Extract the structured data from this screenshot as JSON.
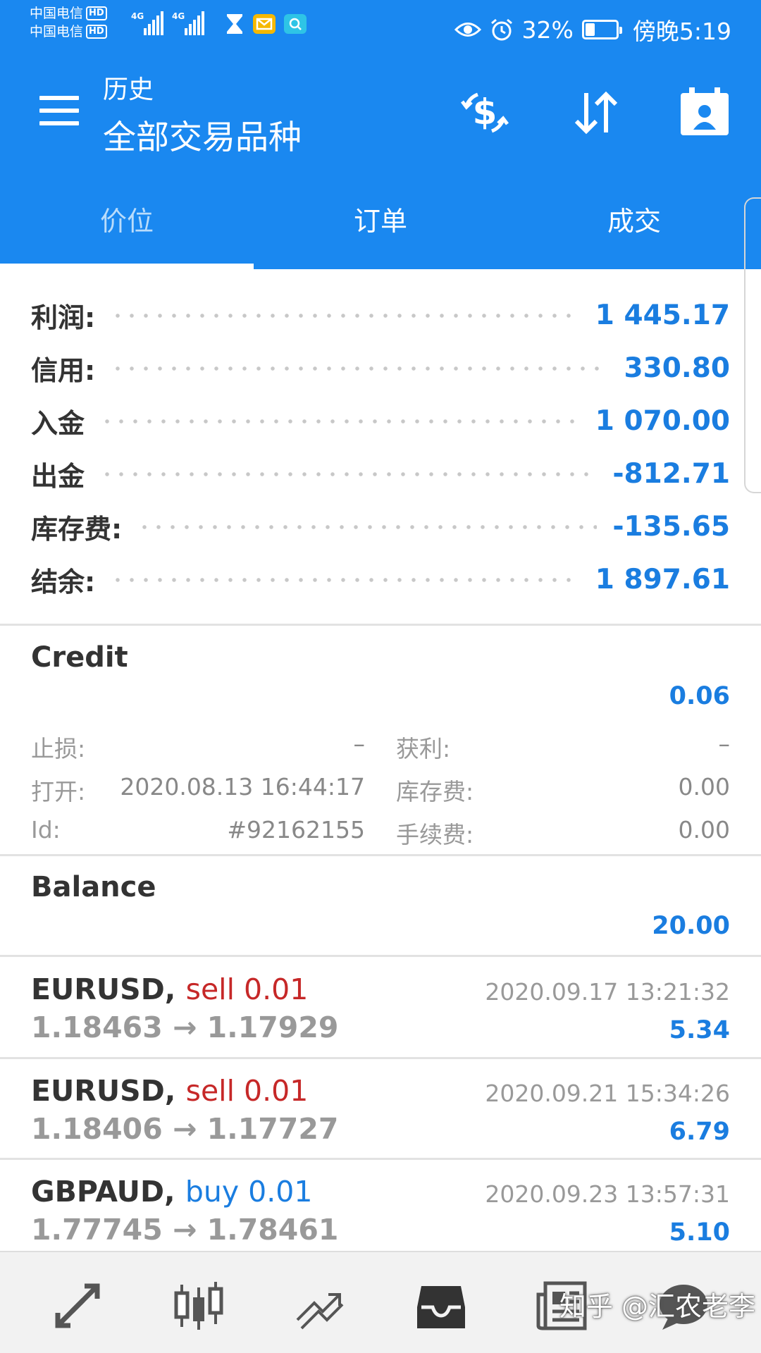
{
  "status_bar": {
    "carrier1": "中国电信",
    "carrier2": "中国电信",
    "hd_badge": "HD",
    "signal1_label": "4G",
    "signal2_label": "4G",
    "battery_text": "32%",
    "battery_fraction": 0.32,
    "clock": "傍晚5:19"
  },
  "app_bar": {
    "title_small": "历史",
    "title_large": "全部交易品种"
  },
  "tabs": [
    {
      "label": "价位"
    },
    {
      "label": "订单"
    },
    {
      "label": "成交"
    }
  ],
  "summary": [
    {
      "label": "利润:",
      "value": "1 445.17"
    },
    {
      "label": "信用:",
      "value": "330.80"
    },
    {
      "label": "入金",
      "value": "1 070.00"
    },
    {
      "label": "出金",
      "value": "-812.71"
    },
    {
      "label": "库存费:",
      "value": "-135.65"
    },
    {
      "label": "结余:",
      "value": "1 897.61"
    }
  ],
  "credit": {
    "title": "Credit",
    "amount": "0.06",
    "stop_loss_label": "止损:",
    "stop_loss_value": "–",
    "take_profit_label": "获利:",
    "take_profit_value": "–",
    "open_label": "打开:",
    "open_value": "2020.08.13 16:44:17",
    "swap_label": "库存费:",
    "swap_value": "0.00",
    "id_label": "Id:",
    "id_value": "#92162155",
    "commission_label": "手续费:",
    "commission_value": "0.00"
  },
  "balance": {
    "title": "Balance",
    "amount": "20.00"
  },
  "deals": [
    {
      "symbol": "EURUSD,",
      "side": "sell 0.01",
      "prices": "1.18463 → 1.17929",
      "time": "2020.09.17 13:21:32",
      "profit": "5.34"
    },
    {
      "symbol": "EURUSD,",
      "side": "sell 0.01",
      "prices": "1.18406 → 1.17727",
      "time": "2020.09.21 15:34:26",
      "profit": "6.79"
    },
    {
      "symbol": "GBPAUD,",
      "side": "buy 0.01",
      "prices": "1.77745 → 1.78461",
      "time": "2020.09.23 13:57:31",
      "profit": "5.10"
    }
  ],
  "watermark": "知乎 @汇农老李",
  "colors": {
    "brand_blue": "#1a88f0",
    "value_blue": "#1a7de0",
    "sell_red": "#c62828"
  },
  "icons": {
    "menu": "hamburger-menu-icon",
    "currency": "dollar-exchange-icon",
    "sort": "sort-arrows-icon",
    "account": "account-card-icon",
    "nav": [
      "quotes-icon",
      "chart-icon",
      "trade-icon",
      "history-icon",
      "news-icon",
      "chat-icon"
    ]
  }
}
